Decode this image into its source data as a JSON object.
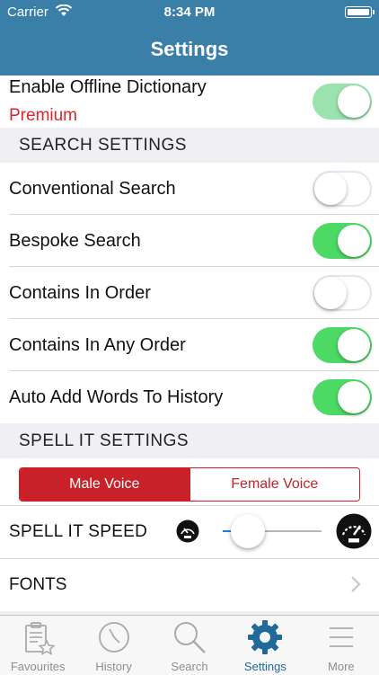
{
  "status": {
    "carrier": "Carrier",
    "time": "8:34 PM"
  },
  "nav": {
    "title": "Settings"
  },
  "offline": {
    "label": "Enable Offline Dictionary",
    "sublabel": "Premium",
    "enabled": true
  },
  "search_settings": {
    "header": "SEARCH SETTINGS",
    "items": [
      {
        "label": "Conventional Search",
        "on": false
      },
      {
        "label": "Bespoke Search",
        "on": true
      },
      {
        "label": "Contains In Order",
        "on": false
      },
      {
        "label": "Contains In Any Order",
        "on": true
      },
      {
        "label": "Auto Add Words To History",
        "on": true
      }
    ]
  },
  "spell_settings": {
    "header": "SPELL IT SETTINGS",
    "voices": [
      "Male Voice",
      "Female Voice"
    ],
    "selected_voice": "Male Voice",
    "speed_label": "SPELL IT SPEED",
    "speed_fraction": 0.25
  },
  "fonts": {
    "label": "FONTS"
  },
  "tabs": [
    {
      "label": "Favourites",
      "icon": "favourites-icon",
      "active": false
    },
    {
      "label": "History",
      "icon": "history-icon",
      "active": false
    },
    {
      "label": "Search",
      "icon": "search-icon",
      "active": false
    },
    {
      "label": "Settings",
      "icon": "gear-icon",
      "active": true
    },
    {
      "label": "More",
      "icon": "more-icon",
      "active": false
    }
  ],
  "colors": {
    "bar": "#3a7fa8",
    "toggle_on": "#4cd964",
    "accent_red": "#c82129",
    "premium": "#e0232b",
    "tab_active": "#1f6a9b"
  }
}
